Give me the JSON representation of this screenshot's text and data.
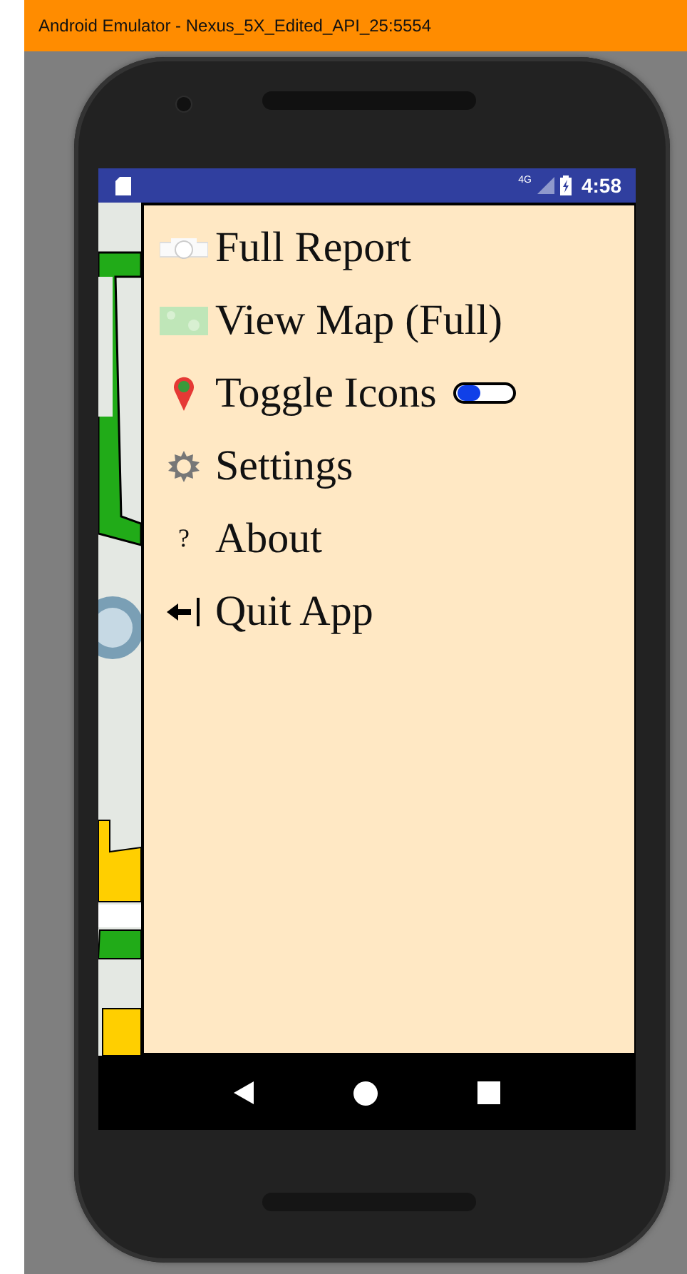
{
  "window": {
    "title": "Android Emulator - Nexus_5X_Edited_API_25:5554"
  },
  "status_bar": {
    "network": "4G",
    "time": "4:58"
  },
  "menu": [
    {
      "kind": "report",
      "label": "Full Report"
    },
    {
      "kind": "map",
      "label": "View Map (Full)"
    },
    {
      "kind": "toggle",
      "label": "Toggle Icons",
      "on": false
    },
    {
      "kind": "settings",
      "label": "Settings"
    },
    {
      "kind": "about",
      "label": "About",
      "glyph": "?"
    },
    {
      "kind": "quit",
      "label": "Quit App"
    }
  ]
}
